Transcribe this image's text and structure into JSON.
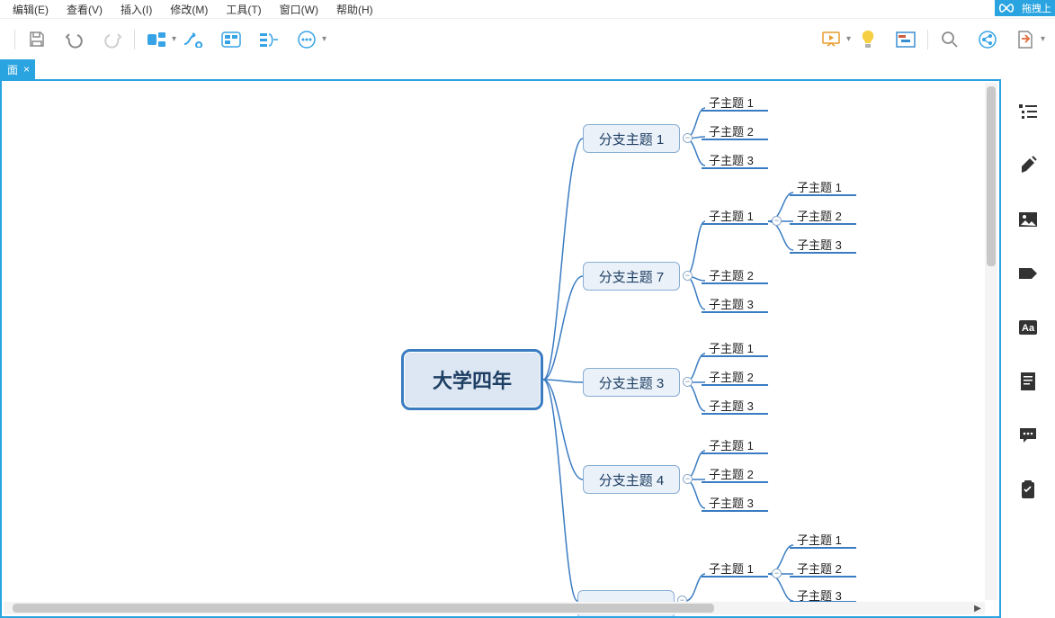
{
  "menu": {
    "edit": "编辑(E)",
    "view": "查看(V)",
    "insert": "插入(I)",
    "modify": "修改(M)",
    "tools": "工具(T)",
    "window": "窗口(W)",
    "help": "帮助(H)"
  },
  "top_right": {
    "drag_label": "拖拽上"
  },
  "tab": {
    "close": "×"
  },
  "mindmap": {
    "central": "大学四年",
    "branches": [
      {
        "label": "分支主题 1",
        "children": [
          {
            "label": "子主题 1"
          },
          {
            "label": "子主题 2"
          },
          {
            "label": "子主题 3"
          }
        ]
      },
      {
        "label": "分支主题 7",
        "children": [
          {
            "label": "子主题 1",
            "children": [
              {
                "label": "子主题 1"
              },
              {
                "label": "子主题 2"
              },
              {
                "label": "子主题 3"
              }
            ]
          },
          {
            "label": "子主题 2"
          },
          {
            "label": "子主题 3"
          }
        ]
      },
      {
        "label": "分支主题 3",
        "children": [
          {
            "label": "子主题 1"
          },
          {
            "label": "子主题 2"
          },
          {
            "label": "子主题 3"
          }
        ]
      },
      {
        "label": "分支主题 4",
        "children": [
          {
            "label": "子主题 1"
          },
          {
            "label": "子主题 2"
          },
          {
            "label": "子主题 3"
          }
        ]
      },
      {
        "label": "",
        "children": [
          {
            "label": "子主题 1",
            "children": [
              {
                "label": "子主题 1"
              },
              {
                "label": "子主题 2"
              },
              {
                "label": "子主题 3"
              }
            ]
          }
        ]
      }
    ]
  }
}
